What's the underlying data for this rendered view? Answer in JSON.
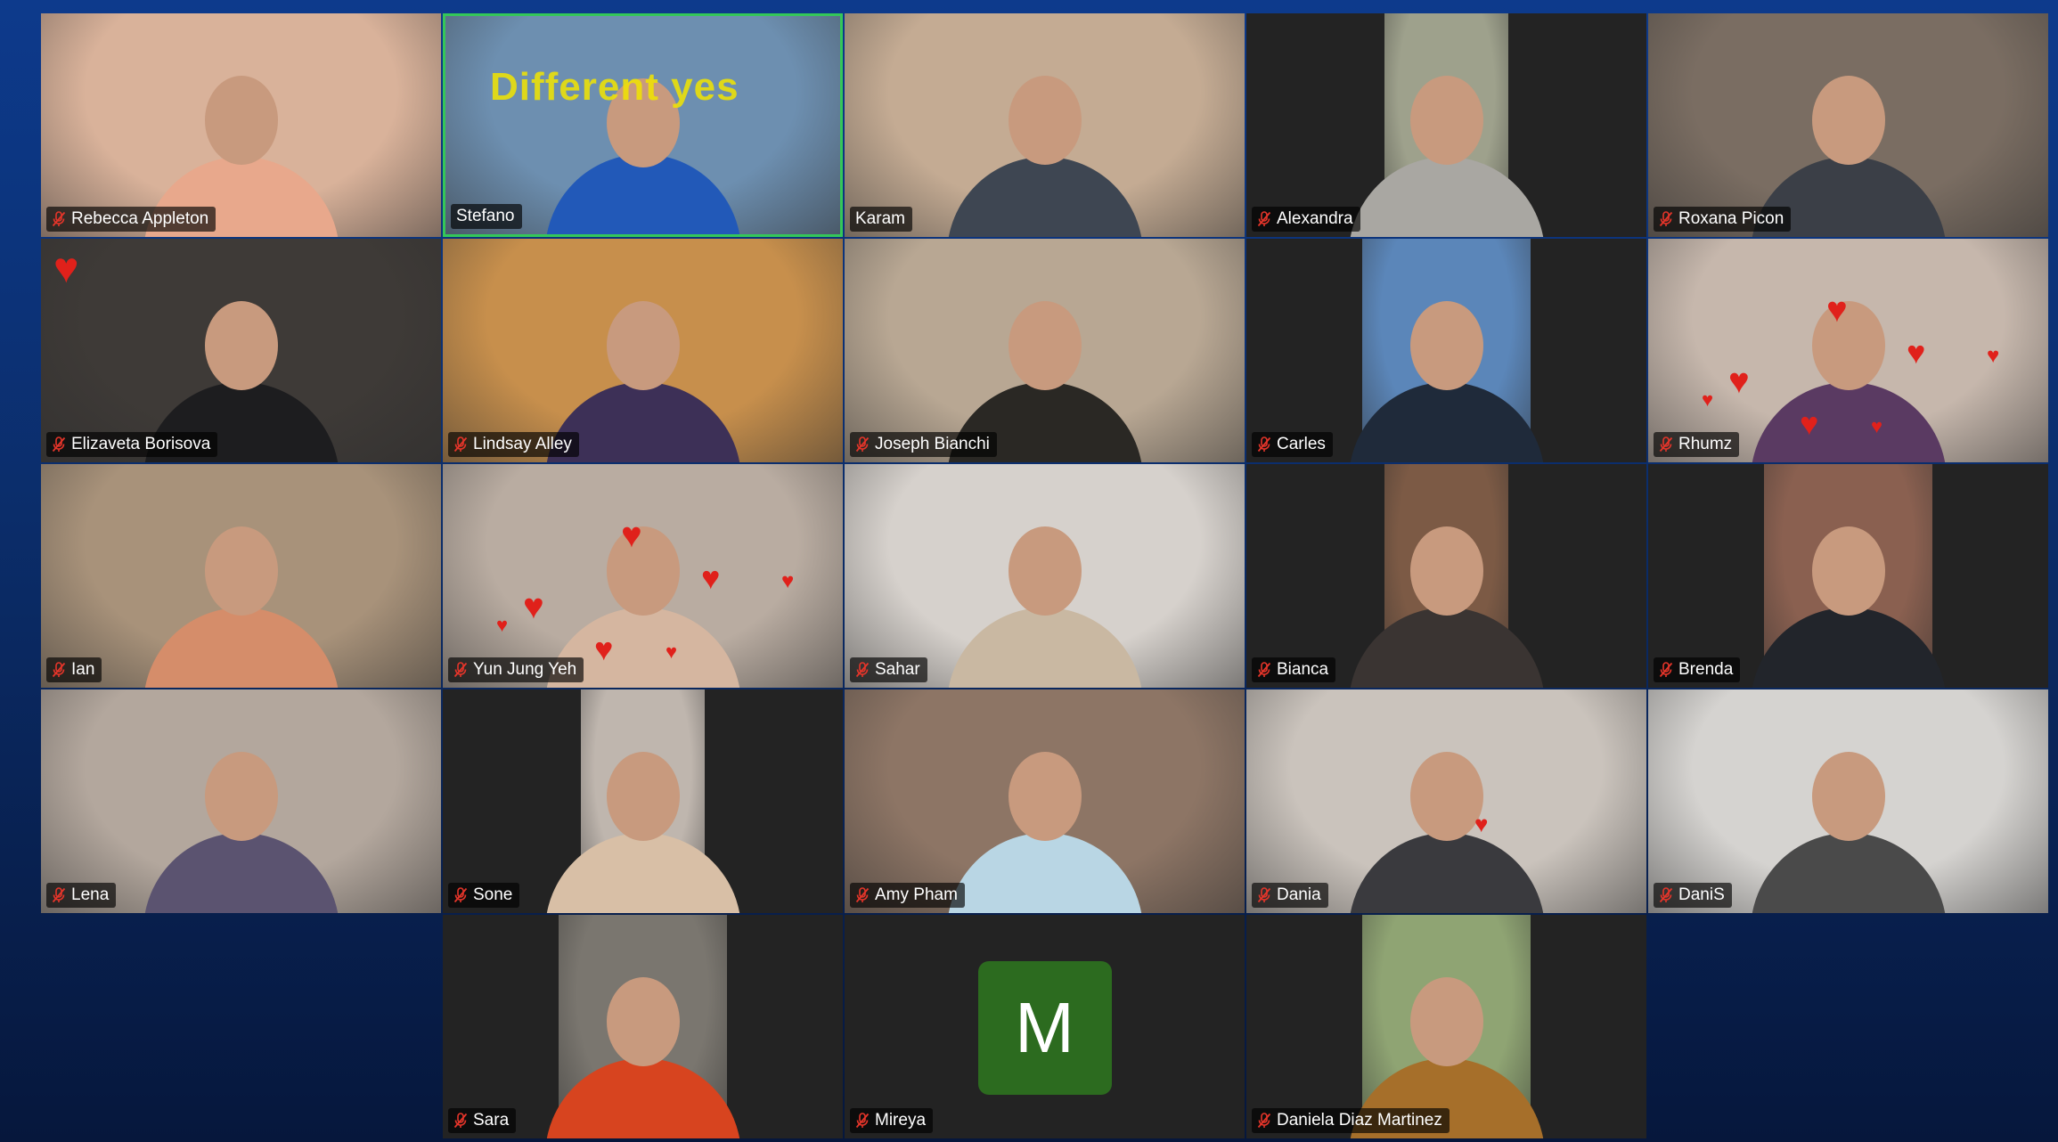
{
  "meeting": {
    "tiles": [
      {
        "name": "Rebecca Appleton",
        "muted": true,
        "bg": "#d9b29a",
        "shirt": "#e8a88c"
      },
      {
        "name": "Stefano",
        "muted": false,
        "active": true,
        "bg": "#6d8fb0",
        "shirt": "#2259b8",
        "overlay": "Different yes"
      },
      {
        "name": "Karam",
        "muted": false,
        "bg": "#c4ab93",
        "shirt": "#3e4652"
      },
      {
        "name": "Alexandra",
        "muted": true,
        "bg": "#9ea18c",
        "shirt": "#a9a7a2",
        "layout": "narrow"
      },
      {
        "name": "Roxana Picon",
        "muted": true,
        "bg": "#7a6d62",
        "shirt": "#3b3f47"
      },
      {
        "name": "Elizaveta Borisova",
        "muted": true,
        "bg": "#3e3a37",
        "shirt": "#1d1d1f",
        "reaction": "heart-large"
      },
      {
        "name": "Lindsay Alley",
        "muted": true,
        "bg": "#c78f4c",
        "shirt": "#3d3057"
      },
      {
        "name": "Joseph Bianchi",
        "muted": true,
        "bg": "#b8a793",
        "shirt": "#2a2824"
      },
      {
        "name": "Carles",
        "muted": true,
        "bg": "#5b86b9",
        "shirt": "#1f2a3a",
        "layout": "med"
      },
      {
        "name": "Rhumz",
        "muted": true,
        "bg": "#c6b7ac",
        "shirt": "#5a3a62",
        "reaction": "hearts-many"
      },
      {
        "name": "Ian",
        "muted": true,
        "bg": "#a8927a",
        "shirt": "#d58d6a"
      },
      {
        "name": "Yun Jung Yeh",
        "muted": true,
        "bg": "#b9aca1",
        "shirt": "#d5b6a0",
        "reaction": "hearts-many"
      },
      {
        "name": "Sahar",
        "muted": true,
        "bg": "#d6d1cc",
        "shirt": "#c9b8a2"
      },
      {
        "name": "Bianca",
        "muted": true,
        "bg": "#7c5a45",
        "shirt": "#3a3432",
        "layout": "narrow"
      },
      {
        "name": "Brenda",
        "muted": true,
        "bg": "#8a6050",
        "shirt": "#22252b",
        "layout": "med"
      },
      {
        "name": "Lena",
        "muted": true,
        "bg": "#b3a79d",
        "shirt": "#5b5370"
      },
      {
        "name": "Sone",
        "muted": true,
        "bg": "#bfb6ae",
        "shirt": "#d8bfa6",
        "layout": "narrow"
      },
      {
        "name": "Amy Pham",
        "muted": true,
        "bg": "#8d7565",
        "shirt": "#b9d6e4"
      },
      {
        "name": "Dania",
        "muted": true,
        "bg": "#cac3bc",
        "shirt": "#3a3a3e",
        "reaction": "heart-small"
      },
      {
        "name": "DaniS",
        "muted": true,
        "bg": "#d5d3d0",
        "shirt": "#4a4a4a"
      },
      {
        "name": "Sara",
        "muted": true,
        "bg": "#7a766f",
        "shirt": "#d7441f",
        "layout": "med"
      },
      {
        "name": "Mireya",
        "muted": true,
        "avatar_letter": "M",
        "avatar_color": "#2c6b1f"
      },
      {
        "name": "Daniela Diaz Martinez",
        "muted": true,
        "bg": "#8fa473",
        "shirt": "#a66f2a",
        "layout": "small-center"
      }
    ],
    "icons": {
      "muted_mic": "mic-muted-icon",
      "heart_reaction": "heart-icon"
    },
    "colors": {
      "active_speaker_border": "#34c759",
      "muted_icon": "#e5352a",
      "tile_background": "#232323"
    }
  }
}
